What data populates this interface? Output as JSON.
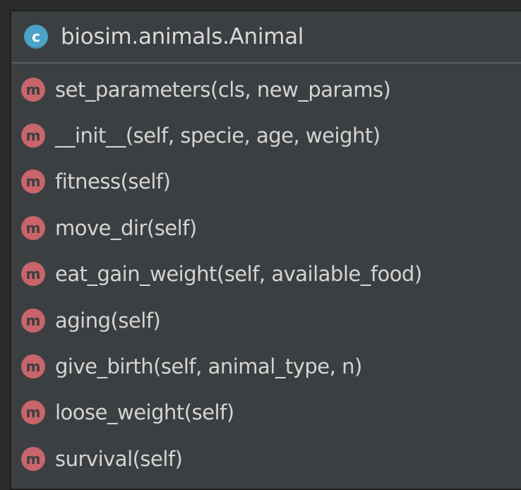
{
  "class": {
    "icon_letter": "c",
    "icon_color": "#4ba4c7",
    "name": "biosim.animals.Animal"
  },
  "method_icon": {
    "letter": "m",
    "color": "#c8656a"
  },
  "methods": [
    {
      "signature": "set_parameters(cls, new_params)"
    },
    {
      "signature": "__init__(self, specie, age, weight)"
    },
    {
      "signature": "fitness(self)"
    },
    {
      "signature": "move_dir(self)"
    },
    {
      "signature": "eat_gain_weight(self, available_food)"
    },
    {
      "signature": "aging(self)"
    },
    {
      "signature": "give_birth(self, animal_type, n)"
    },
    {
      "signature": "loose_weight(self)"
    },
    {
      "signature": "survival(self)"
    }
  ]
}
